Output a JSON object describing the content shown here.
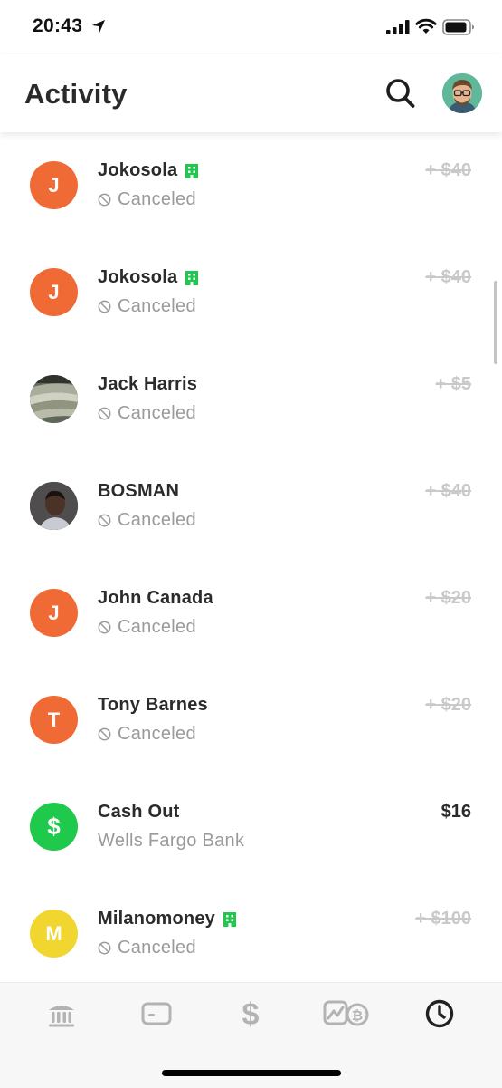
{
  "status_bar": {
    "time": "20:43"
  },
  "header": {
    "title": "Activity"
  },
  "transactions": [
    {
      "name": "Jokosola",
      "business": true,
      "status": "Canceled",
      "amount": "+ $40",
      "canceled": true,
      "initial": "J",
      "avatar_color": "#f06a35"
    },
    {
      "name": "Jokosola",
      "business": true,
      "status": "Canceled",
      "amount": "+ $40",
      "canceled": true,
      "initial": "J",
      "avatar_color": "#f06a35"
    },
    {
      "name": "Jack Harris",
      "business": false,
      "status": "Canceled",
      "amount": "+ $5",
      "canceled": true,
      "initial": "",
      "avatar_color": "#6c7566"
    },
    {
      "name": "BOSMAN",
      "business": false,
      "status": "Canceled",
      "amount": "+ $40",
      "canceled": true,
      "initial": "",
      "avatar_color": "#2d221d"
    },
    {
      "name": "John Canada",
      "business": false,
      "status": "Canceled",
      "amount": "+ $20",
      "canceled": true,
      "initial": "J",
      "avatar_color": "#f06a35"
    },
    {
      "name": "Tony Barnes",
      "business": false,
      "status": "Canceled",
      "amount": "+ $20",
      "canceled": true,
      "initial": "T",
      "avatar_color": "#f06a35"
    },
    {
      "name": "Cash Out",
      "business": false,
      "status": "Wells Fargo Bank",
      "amount": "$16",
      "canceled": false,
      "initial": "$",
      "avatar_color": "#1ec94c"
    },
    {
      "name": "Milanomoney",
      "business": true,
      "status": "Canceled",
      "amount": "+ $100",
      "canceled": true,
      "initial": "M",
      "avatar_color": "#f2d630"
    }
  ],
  "tab_bar": {
    "tabs": [
      {
        "icon": "bank-icon",
        "active": false
      },
      {
        "icon": "card-icon",
        "active": false
      },
      {
        "icon": "dollar-icon",
        "active": false
      },
      {
        "icon": "investing-icon",
        "active": false
      },
      {
        "icon": "clock-icon",
        "active": true
      }
    ]
  },
  "colors": {
    "accent_green": "#1ec94c",
    "business_badge": "#1ec94c",
    "canceled_text": "#9a9a9a",
    "canceled_amount": "#c9c9c9",
    "tab_inactive": "#b3b3b3",
    "tab_active": "#222222"
  }
}
